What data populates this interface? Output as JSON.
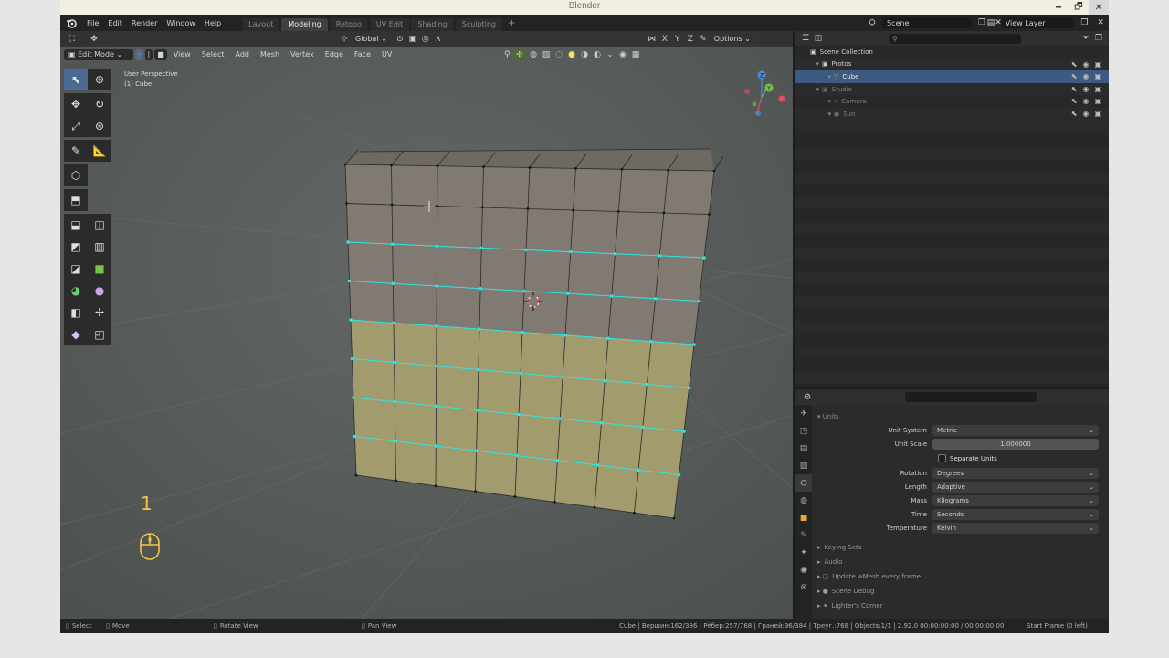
{
  "window": {
    "title": "Blender",
    "min": "🗕",
    "max": "🗗",
    "close": "✕"
  },
  "menu": [
    "File",
    "Edit",
    "Render",
    "Window",
    "Help"
  ],
  "workspaces": [
    {
      "label": "Layout",
      "active": false
    },
    {
      "label": "Modeling",
      "active": true
    },
    {
      "label": "Retopo",
      "active": false
    },
    {
      "label": "UV Edit",
      "active": false
    },
    {
      "label": "Shading",
      "active": false
    },
    {
      "label": "Sculpting",
      "active": false
    }
  ],
  "workspace_add": "+",
  "scene": {
    "name": "Scene",
    "view_layer": "View Layer"
  },
  "viewport": {
    "transform_orientation": "Global",
    "options_label": "Options",
    "axes": [
      "X",
      "Y",
      "Z"
    ],
    "mode": "Edit Mode",
    "menus": [
      "View",
      "Select",
      "Add",
      "Mesh",
      "Vertex",
      "Edge",
      "Face",
      "UV"
    ],
    "perspective": "User Perspective",
    "object_label": "(1) Cube",
    "key_hint": "1",
    "gizmo_axes": {
      "x": "X",
      "y": "Y",
      "z": "Z"
    }
  },
  "colors": {
    "accent": "#4a6b93",
    "selected_vertex": "#2ee6e6",
    "selected_face": "#c9c46a",
    "gizmo_x": "#e84a5f",
    "gizmo_y": "#7cc242",
    "gizmo_z": "#4a8bd8",
    "key_hint": "#f4c542"
  },
  "outliner": {
    "rows": [
      {
        "label": "Scene Collection",
        "indent": 0,
        "icon": "collection-icon",
        "state": "normal"
      },
      {
        "label": "Protos",
        "indent": 1,
        "icon": "collection-icon",
        "state": "normal"
      },
      {
        "label": "Cube",
        "indent": 2,
        "icon": "mesh-icon",
        "state": "active"
      },
      {
        "label": "Studio",
        "indent": 1,
        "icon": "collection-icon",
        "state": "dim"
      },
      {
        "label": "Camera",
        "indent": 2,
        "icon": "camera-icon",
        "state": "dim"
      },
      {
        "label": "Sun",
        "indent": 2,
        "icon": "light-icon",
        "state": "dim"
      }
    ]
  },
  "properties": {
    "panel_title": "Units",
    "fields": [
      {
        "label": "Unit System",
        "value": "Metric",
        "type": "dropdown"
      },
      {
        "label": "Unit Scale",
        "value": "1.000000",
        "type": "number"
      },
      {
        "label": "Rotation",
        "value": "Degrees",
        "type": "dropdown"
      },
      {
        "label": "Length",
        "value": "Adaptive",
        "type": "dropdown"
      },
      {
        "label": "Mass",
        "value": "Kilograms",
        "type": "dropdown"
      },
      {
        "label": "Time",
        "value": "Seconds",
        "type": "dropdown"
      },
      {
        "label": "Temperature",
        "value": "Kelvin",
        "type": "dropdown"
      }
    ],
    "separate_units": "Separate Units",
    "subpanels": [
      "Keying Sets",
      "Audio",
      "Update wMesh every frame",
      "Scene Debug",
      "Lighter's Corner"
    ]
  },
  "status": {
    "select": "Select",
    "move": "Move",
    "rotate": "Rotate View",
    "pan": "Pan View",
    "stats": "Cube | Вершин:162/386 | Рёбер:257/768 | Граней:96/384 | Треуг.:768 | Objects:1/1 | 2.92.0  00:00:00:00 / 00:00:00:00",
    "start_frame": "Start Frame (0 left)"
  }
}
